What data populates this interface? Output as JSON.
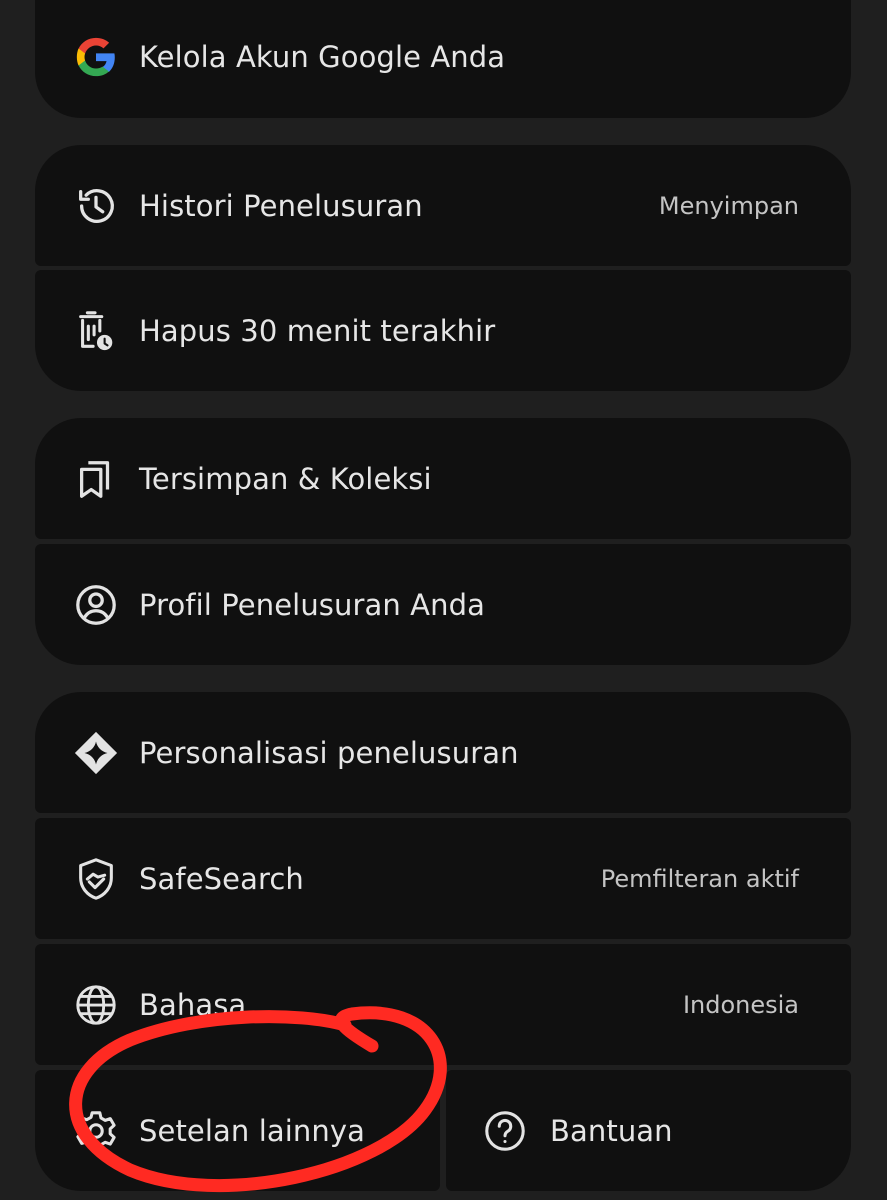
{
  "account": {
    "manage_label": "Kelola Akun Google Anda"
  },
  "history": {
    "search_history_label": "Histori Penelusuran",
    "search_history_value": "Menyimpan",
    "delete_last_label": "Hapus 30 menit terakhir"
  },
  "saved": {
    "collections_label": "Tersimpan & Koleksi",
    "profile_label": "Profil Penelusuran Anda"
  },
  "settings": {
    "personalization_label": "Personalisasi penelusuran",
    "safesearch_label": "SafeSearch",
    "safesearch_value": "Pemfilteran aktif",
    "language_label": "Bahasa",
    "language_value": "Indonesia",
    "more_settings_label": "Setelan lainnya",
    "help_label": "Bantuan"
  },
  "icons": {
    "google": "google-logo-icon",
    "history": "history-icon",
    "delete_recent": "delete-clock-icon",
    "saved": "bookmarks-icon",
    "profile": "account-circle-icon",
    "personalization": "sparkle-diamond-icon",
    "safesearch": "shield-handshake-icon",
    "language": "globe-icon",
    "settings": "gear-icon",
    "help": "help-circle-icon"
  },
  "colors": {
    "background": "#1f1f1f",
    "card": "#101010",
    "text": "#e6e6e6",
    "secondary_text": "#c4c4c4",
    "annotation": "#ff2a22"
  }
}
